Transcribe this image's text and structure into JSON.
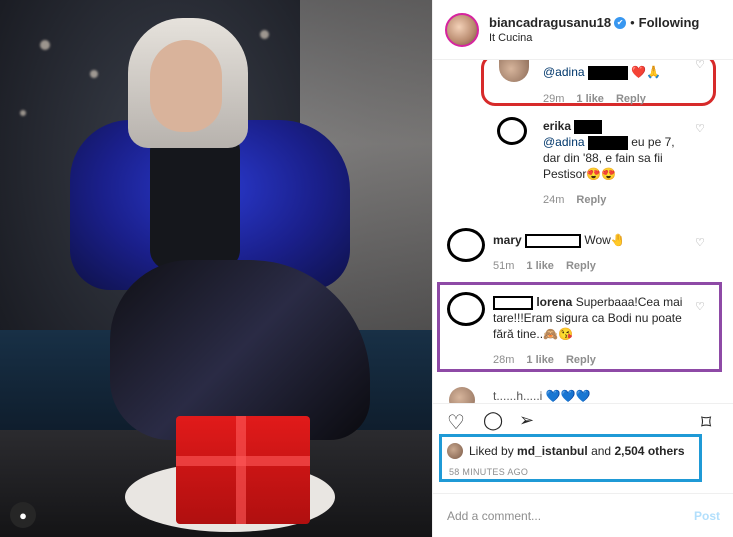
{
  "header": {
    "username": "biancadragusanu18",
    "dot": "•",
    "follow_label": "Following",
    "location": "It Cucina",
    "verified_icon": "✔"
  },
  "comments": [
    {
      "user": "",
      "mention": "@adina",
      "text": "❤️🙏",
      "time": "29m",
      "likes": "1 like",
      "reply": "Reply"
    },
    {
      "user": "erika",
      "mention": "@adina",
      "text": "eu pe 7, dar din '88, e fain sa fii Pestisor😍😍",
      "time": "24m",
      "likes": "",
      "reply": "Reply"
    },
    {
      "user": "mary",
      "mention": "",
      "text": "Wow🤚",
      "time": "51m",
      "likes": "1 like",
      "reply": "Reply"
    },
    {
      "user": "lorena",
      "mention": "",
      "text": "Superbaaa!Cea mai tare!!!Eram sigura ca Bodi nu poate fără tine..🙈😘",
      "time": "28m",
      "likes": "1 like",
      "reply": "Reply"
    }
  ],
  "partial_comment": "t......h.....i 💙💙💙",
  "likes": {
    "prefix": "Liked by",
    "user": "md_istanbul",
    "and": "and",
    "count": "2,504 others",
    "time": "58 MINUTES AGO"
  },
  "add_comment": {
    "placeholder": "Add a comment...",
    "post_label": "Post"
  },
  "icons": {
    "heart": "♡",
    "comment": "◯",
    "share": "➢",
    "bookmark": "⌑",
    "user_tag": "●"
  },
  "colors": {
    "highlight_red": "#d72a2a",
    "highlight_purple": "#8e4aa6",
    "highlight_blue": "#1f9ad6",
    "link": "#00376b",
    "muted": "#8e8e8e"
  }
}
